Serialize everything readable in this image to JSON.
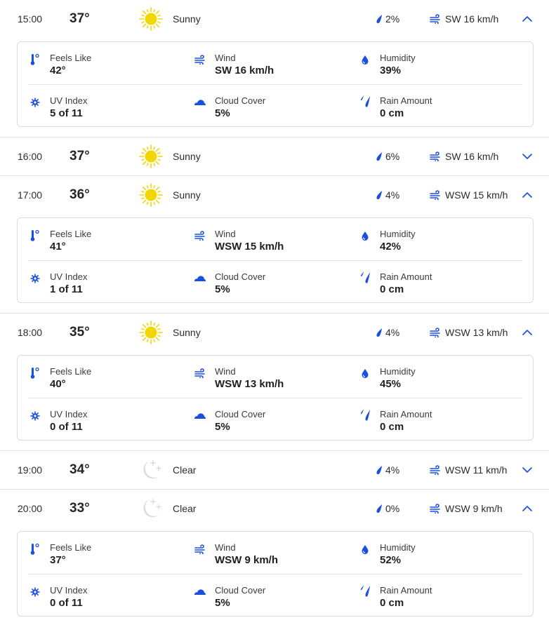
{
  "colors": {
    "accent": "#1a4fe0",
    "sun": "#f2d600",
    "moon": "#d9d9d9"
  },
  "labels": {
    "feels_like": "Feels Like",
    "wind": "Wind",
    "humidity": "Humidity",
    "uv_index": "UV Index",
    "cloud_cover": "Cloud Cover",
    "rain_amount": "Rain Amount"
  },
  "hours": [
    {
      "time": "15:00",
      "temp": "37°",
      "icon": "sun-icon",
      "condition": "Sunny",
      "precip": "2%",
      "wind": "SW 16 km/h",
      "expanded": true,
      "details": {
        "feels_like": "42°",
        "wind": "SW 16 km/h",
        "humidity": "39%",
        "uv_index": "5 of 11",
        "cloud_cover": "5%",
        "rain_amount": "0 cm"
      }
    },
    {
      "time": "16:00",
      "temp": "37°",
      "icon": "sun-icon",
      "condition": "Sunny",
      "precip": "6%",
      "wind": "SW 16 km/h",
      "expanded": false
    },
    {
      "time": "17:00",
      "temp": "36°",
      "icon": "sun-icon",
      "condition": "Sunny",
      "precip": "4%",
      "wind": "WSW 15 km/h",
      "expanded": true,
      "details": {
        "feels_like": "41°",
        "wind": "WSW 15 km/h",
        "humidity": "42%",
        "uv_index": "1 of 11",
        "cloud_cover": "5%",
        "rain_amount": "0 cm"
      }
    },
    {
      "time": "18:00",
      "temp": "35°",
      "icon": "sun-icon",
      "condition": "Sunny",
      "precip": "4%",
      "wind": "WSW 13 km/h",
      "expanded": true,
      "details": {
        "feels_like": "40°",
        "wind": "WSW 13 km/h",
        "humidity": "45%",
        "uv_index": "0 of 11",
        "cloud_cover": "5%",
        "rain_amount": "0 cm"
      }
    },
    {
      "time": "19:00",
      "temp": "34°",
      "icon": "moon-icon",
      "condition": "Clear",
      "precip": "4%",
      "wind": "WSW 11 km/h",
      "expanded": false
    },
    {
      "time": "20:00",
      "temp": "33°",
      "icon": "moon-icon",
      "condition": "Clear",
      "precip": "0%",
      "wind": "WSW 9 km/h",
      "expanded": true,
      "details": {
        "feels_like": "37°",
        "wind": "WSW 9 km/h",
        "humidity": "52%",
        "uv_index": "0 of 11",
        "cloud_cover": "5%",
        "rain_amount": "0 cm"
      }
    }
  ]
}
